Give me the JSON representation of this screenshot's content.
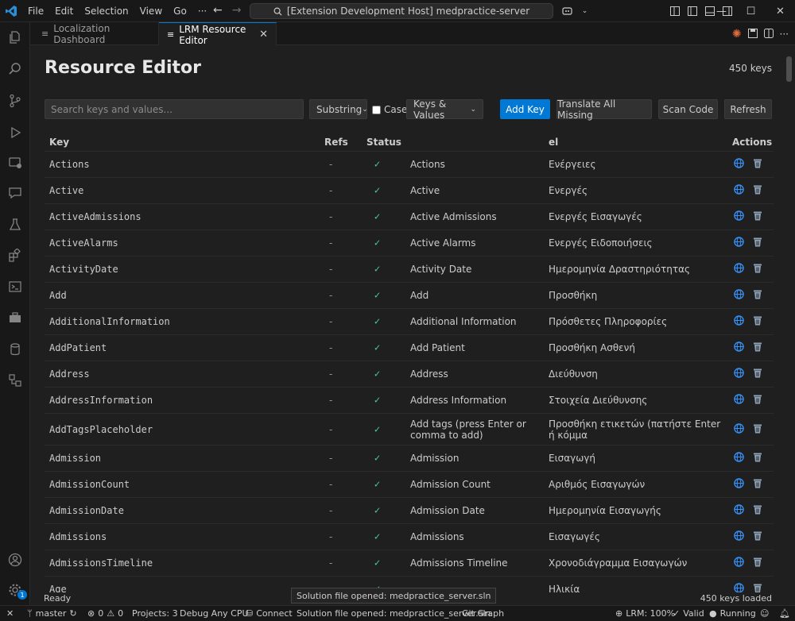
{
  "titlebar": {
    "menu": [
      "File",
      "Edit",
      "Selection",
      "View",
      "Go",
      "···"
    ],
    "command_center": "[Extension Development Host] medpractice-server",
    "window_controls": [
      "—",
      "☐",
      "✕"
    ]
  },
  "tabs": [
    {
      "label": "Localization Dashboard",
      "active": false
    },
    {
      "label": "LRM Resource Editor",
      "active": true
    }
  ],
  "editor": {
    "title": "Resource Editor",
    "key_count": "450 keys",
    "search_placeholder": "Search keys and values...",
    "match_mode": "Substring",
    "case_label": "Case",
    "scope": "Keys & Values",
    "buttons": {
      "add_key": "Add Key",
      "translate_all": "Translate All Missing",
      "scan_code": "Scan Code",
      "refresh": "Refresh"
    },
    "columns": {
      "key": "Key",
      "refs": "Refs",
      "status": "Status",
      "lang": "el",
      "actions": "Actions"
    },
    "rows": [
      {
        "key": "Actions",
        "refs": "-",
        "value": "Actions",
        "el": "Ενέργειες"
      },
      {
        "key": "Active",
        "refs": "-",
        "value": "Active",
        "el": "Ενεργές"
      },
      {
        "key": "ActiveAdmissions",
        "refs": "-",
        "value": "Active Admissions",
        "el": "Ενεργές Εισαγωγές"
      },
      {
        "key": "ActiveAlarms",
        "refs": "-",
        "value": "Active Alarms",
        "el": "Ενεργές Ειδοποιήσεις"
      },
      {
        "key": "ActivityDate",
        "refs": "-",
        "value": "Activity Date",
        "el": "Ημερομηνία Δραστηριότητας"
      },
      {
        "key": "Add",
        "refs": "-",
        "value": "Add",
        "el": "Προσθήκη"
      },
      {
        "key": "AdditionalInformation",
        "refs": "-",
        "value": "Additional Information",
        "el": "Πρόσθετες Πληροφορίες"
      },
      {
        "key": "AddPatient",
        "refs": "-",
        "value": "Add Patient",
        "el": "Προσθήκη Ασθενή"
      },
      {
        "key": "Address",
        "refs": "-",
        "value": "Address",
        "el": "Διεύθυνση"
      },
      {
        "key": "AddressInformation",
        "refs": "-",
        "value": "Address Information",
        "el": "Στοιχεία Διεύθυνσης"
      },
      {
        "key": "AddTagsPlaceholder",
        "refs": "-",
        "value": "Add tags (press Enter or comma to add)",
        "el": "Προσθήκη ετικετών (πατήστε Enter ή κόμμα"
      },
      {
        "key": "Admission",
        "refs": "-",
        "value": "Admission",
        "el": "Εισαγωγή"
      },
      {
        "key": "AdmissionCount",
        "refs": "-",
        "value": "Admission Count",
        "el": "Αριθμός Εισαγωγών"
      },
      {
        "key": "AdmissionDate",
        "refs": "-",
        "value": "Admission Date",
        "el": "Ημερομηνία Εισαγωγής"
      },
      {
        "key": "Admissions",
        "refs": "-",
        "value": "Admissions",
        "el": "Εισαγωγές"
      },
      {
        "key": "AdmissionsTimeline",
        "refs": "-",
        "value": "Admissions Timeline",
        "el": "Χρονοδιάγραμμα Εισαγωγών"
      },
      {
        "key": "Age",
        "refs": "-",
        "value": "",
        "el": "Ηλικία"
      }
    ],
    "footer_left": "Ready",
    "footer_right": "450 keys loaded"
  },
  "toast": "Solution file opened: medpractice_server.sln",
  "statusbar": {
    "branch": "master",
    "errors": "0",
    "warnings": "0",
    "projects": "Projects: 3",
    "debug": "Debug Any CPU",
    "connect": "Connect",
    "solution": "Solution file opened: medpractice_server.sln",
    "git_graph": "Git Graph",
    "lrm": "LRM: 100%",
    "valid": "Valid",
    "running": "Running"
  },
  "colors": {
    "accent": "#0078d4",
    "check": "#4ec9b0",
    "bg": "#1f1f1f"
  }
}
